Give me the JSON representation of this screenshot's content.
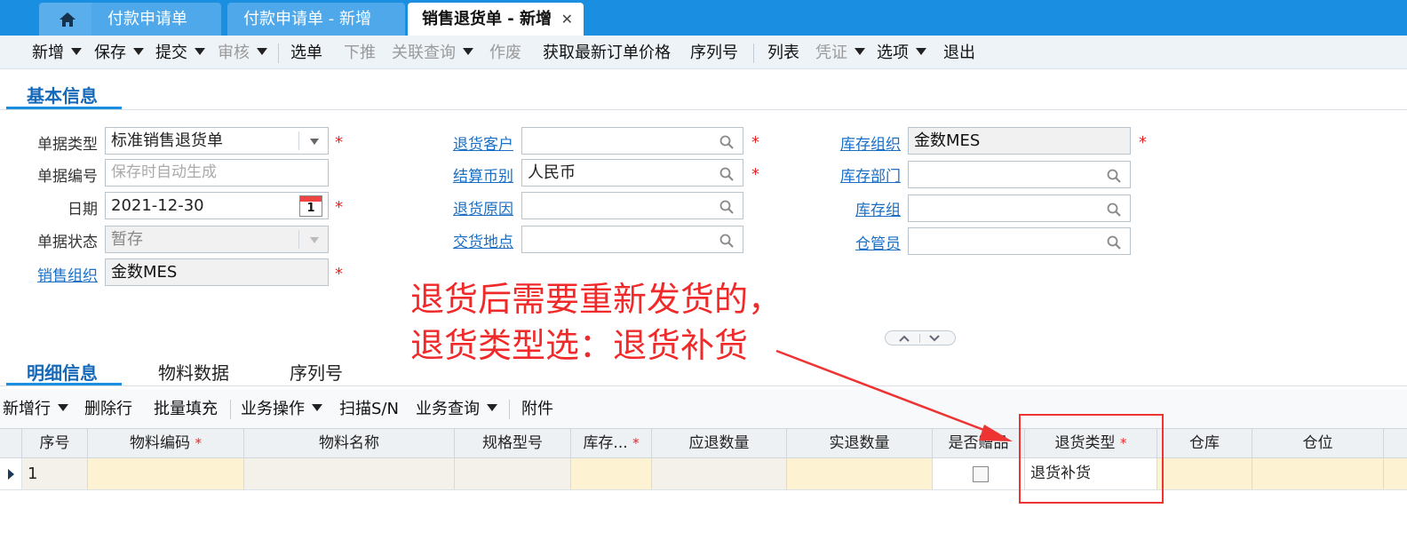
{
  "tabs": [
    {
      "label": "付款申请单"
    },
    {
      "label": "付款申请单 - 新增"
    },
    {
      "label": "销售退货单 - 新增",
      "active": true
    }
  ],
  "toolbar": {
    "add": "新增",
    "save": "保存",
    "submit": "提交",
    "audit": "审核",
    "select_order": "选单",
    "push_down": "下推",
    "related_query": "关联查询",
    "void": "作废",
    "get_latest_price": "获取最新订单价格",
    "serial_no": "序列号",
    "list": "列表",
    "voucher": "凭证",
    "options": "选项",
    "exit": "退出"
  },
  "basic_info": {
    "title": "基本信息",
    "doc_type": {
      "label": "单据类型",
      "value": "标准销售退货单"
    },
    "doc_no": {
      "label": "单据编号",
      "placeholder": "保存时自动生成"
    },
    "date": {
      "label": "日期",
      "value": "2021-12-30",
      "calendar_day": "1"
    },
    "doc_status": {
      "label": "单据状态",
      "value": "暂存"
    },
    "sales_org": {
      "label": "销售组织",
      "value": "金数MES"
    },
    "return_customer": {
      "label": "退货客户",
      "value": ""
    },
    "settle_currency": {
      "label": "结算币别",
      "value": "人民币"
    },
    "return_reason": {
      "label": "退货原因",
      "value": ""
    },
    "delivery_place": {
      "label": "交货地点",
      "value": ""
    },
    "stock_org": {
      "label": "库存组织",
      "value": "金数MES"
    },
    "stock_dept": {
      "label": "库存部门",
      "value": ""
    },
    "stock_group": {
      "label": "库存组",
      "value": ""
    },
    "stock_keeper": {
      "label": "仓管员",
      "value": ""
    }
  },
  "annotation": {
    "line1": "退货后需要重新发货的，",
    "line2": "退货类型选：退货补货"
  },
  "detail_tabs": {
    "detail": "明细信息",
    "material": "物料数据",
    "serial": "序列号"
  },
  "grid_toolbar": {
    "add_row": "新增行",
    "delete_row": "删除行",
    "batch_fill": "批量填充",
    "biz_ops": "业务操作",
    "scan_sn": "扫描S/N",
    "biz_query": "业务查询",
    "attachment": "附件"
  },
  "grid": {
    "columns": [
      "序号",
      "物料编码",
      "物料名称",
      "规格型号",
      "库存...",
      "应退数量",
      "实退数量",
      "是否赠品",
      "退货类型",
      "仓库",
      "仓位"
    ],
    "rows": [
      {
        "seq": "1",
        "return_type": "退货补货"
      }
    ]
  },
  "colors": {
    "accent": "#1a8ee0",
    "required": "#e22222",
    "annotation": "#f02a2a",
    "link": "#1a6fc4"
  }
}
